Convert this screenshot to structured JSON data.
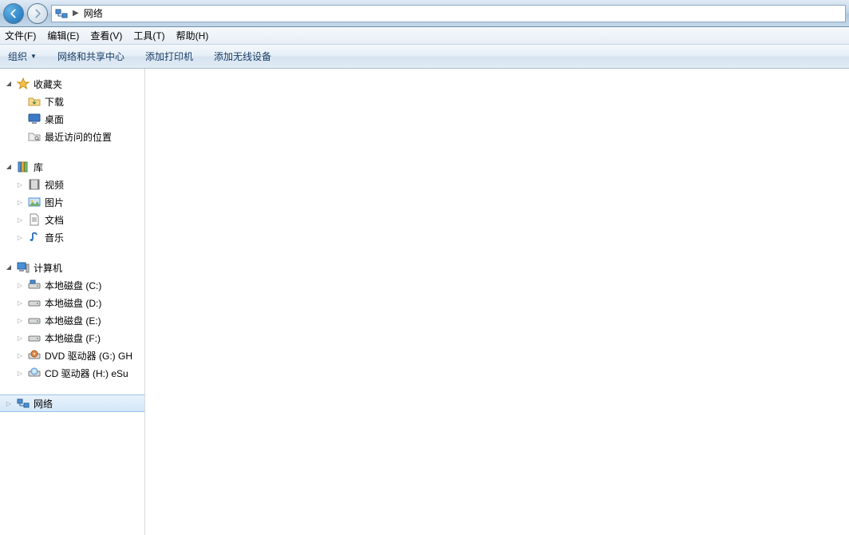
{
  "navbar": {
    "location": "网络"
  },
  "menubar": {
    "file": "文件(F)",
    "edit": "编辑(E)",
    "view": "查看(V)",
    "tools": "工具(T)",
    "help": "帮助(H)"
  },
  "toolbar": {
    "organize": "组织",
    "network_center": "网络和共享中心",
    "add_printer": "添加打印机",
    "add_wireless": "添加无线设备"
  },
  "sidebar": {
    "favorites": {
      "label": "收藏夹",
      "items": [
        {
          "label": "下载"
        },
        {
          "label": "桌面"
        },
        {
          "label": "最近访问的位置"
        }
      ]
    },
    "libraries": {
      "label": "库",
      "items": [
        {
          "label": "视频"
        },
        {
          "label": "图片"
        },
        {
          "label": "文档"
        },
        {
          "label": "音乐"
        }
      ]
    },
    "computer": {
      "label": "计算机",
      "items": [
        {
          "label": "本地磁盘 (C:)"
        },
        {
          "label": "本地磁盘 (D:)"
        },
        {
          "label": "本地磁盘 (E:)"
        },
        {
          "label": "本地磁盘 (F:)"
        },
        {
          "label": "DVD 驱动器 (G:) GH"
        },
        {
          "label": "CD 驱动器 (H:) eSu"
        }
      ]
    },
    "network": {
      "label": "网络"
    }
  }
}
